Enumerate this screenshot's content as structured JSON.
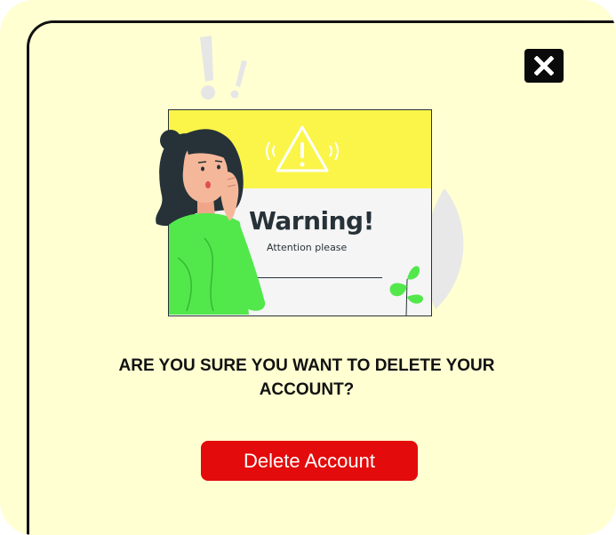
{
  "dialog": {
    "close_icon": "close-icon",
    "illustration": {
      "heading": "Warning!",
      "subheading": "Attention please"
    },
    "message": "ARE YOU SURE YOU WANT TO DELETE YOUR ACCOUNT?",
    "delete_button_label": "Delete Account"
  },
  "colors": {
    "background": "#ffffd2",
    "accent_red": "#e30b0b",
    "warning_yellow": "#fbf54a",
    "shirt_green": "#52e84c"
  }
}
